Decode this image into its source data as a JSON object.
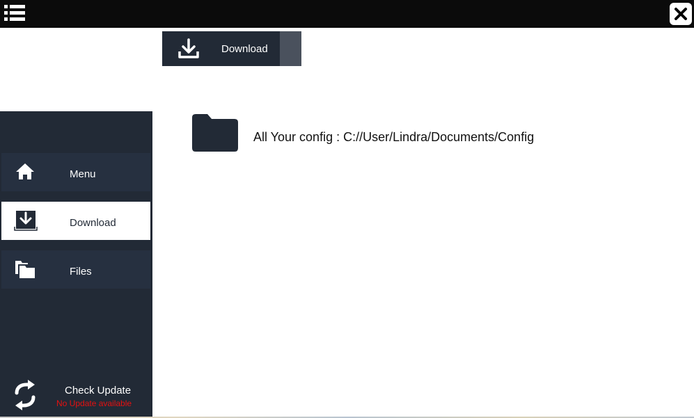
{
  "topbar": {
    "menu_icon": "list-icon",
    "close_icon": "close-icon"
  },
  "toolbar": {
    "download_label": "Download",
    "download_icon": "download-icon"
  },
  "sidebar": {
    "items": [
      {
        "label": "Menu",
        "icon": "home-icon",
        "active": false
      },
      {
        "label": "Download",
        "icon": "download-box-icon",
        "active": true
      },
      {
        "label": "Files",
        "icon": "files-icon",
        "active": false
      }
    ],
    "update": {
      "title": "Check Update",
      "status": "No Update available",
      "icon": "refresh-icon"
    }
  },
  "main": {
    "config_text": "All Your config : C://User/Lindra/Documents/Config",
    "folder_icon": "folder-icon"
  },
  "colors": {
    "sidebar_bg": "#222a36",
    "topbar_bg": "#0b0b0b",
    "status_red": "#e81010"
  }
}
